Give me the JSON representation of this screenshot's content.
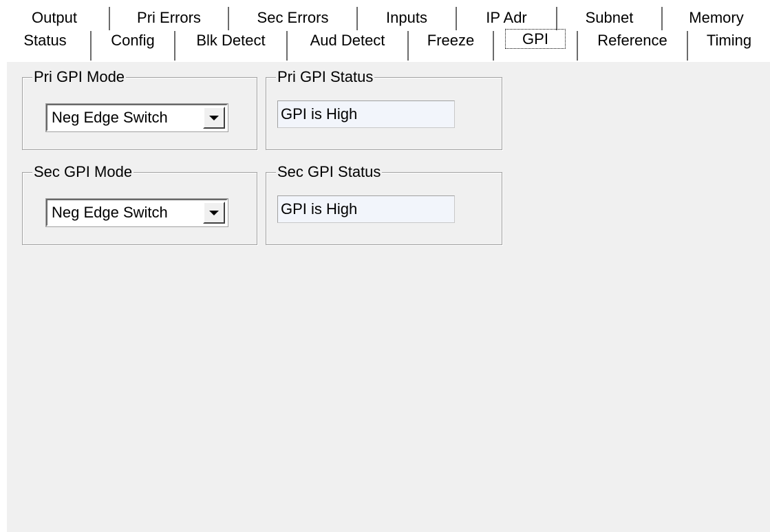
{
  "tabs_back": [
    "Output",
    "Pri Errors",
    "Sec Errors",
    "Inputs",
    "IP Adr",
    "Subnet",
    "Memory"
  ],
  "tabs_front": [
    "Status",
    "Config",
    "Blk Detect",
    "Aud Detect",
    "Freeze",
    "GPI",
    "Reference",
    "Timing"
  ],
  "active_tab": "GPI",
  "gpi": {
    "pri_mode": {
      "legend": "Pri GPI Mode",
      "value": "Neg Edge Switch"
    },
    "pri_status": {
      "legend": "Pri GPI Status",
      "value": "GPI is High"
    },
    "sec_mode": {
      "legend": "Sec GPI Mode",
      "value": "Neg Edge Switch"
    },
    "sec_status": {
      "legend": "Sec GPI Status",
      "value": "GPI is High"
    }
  }
}
